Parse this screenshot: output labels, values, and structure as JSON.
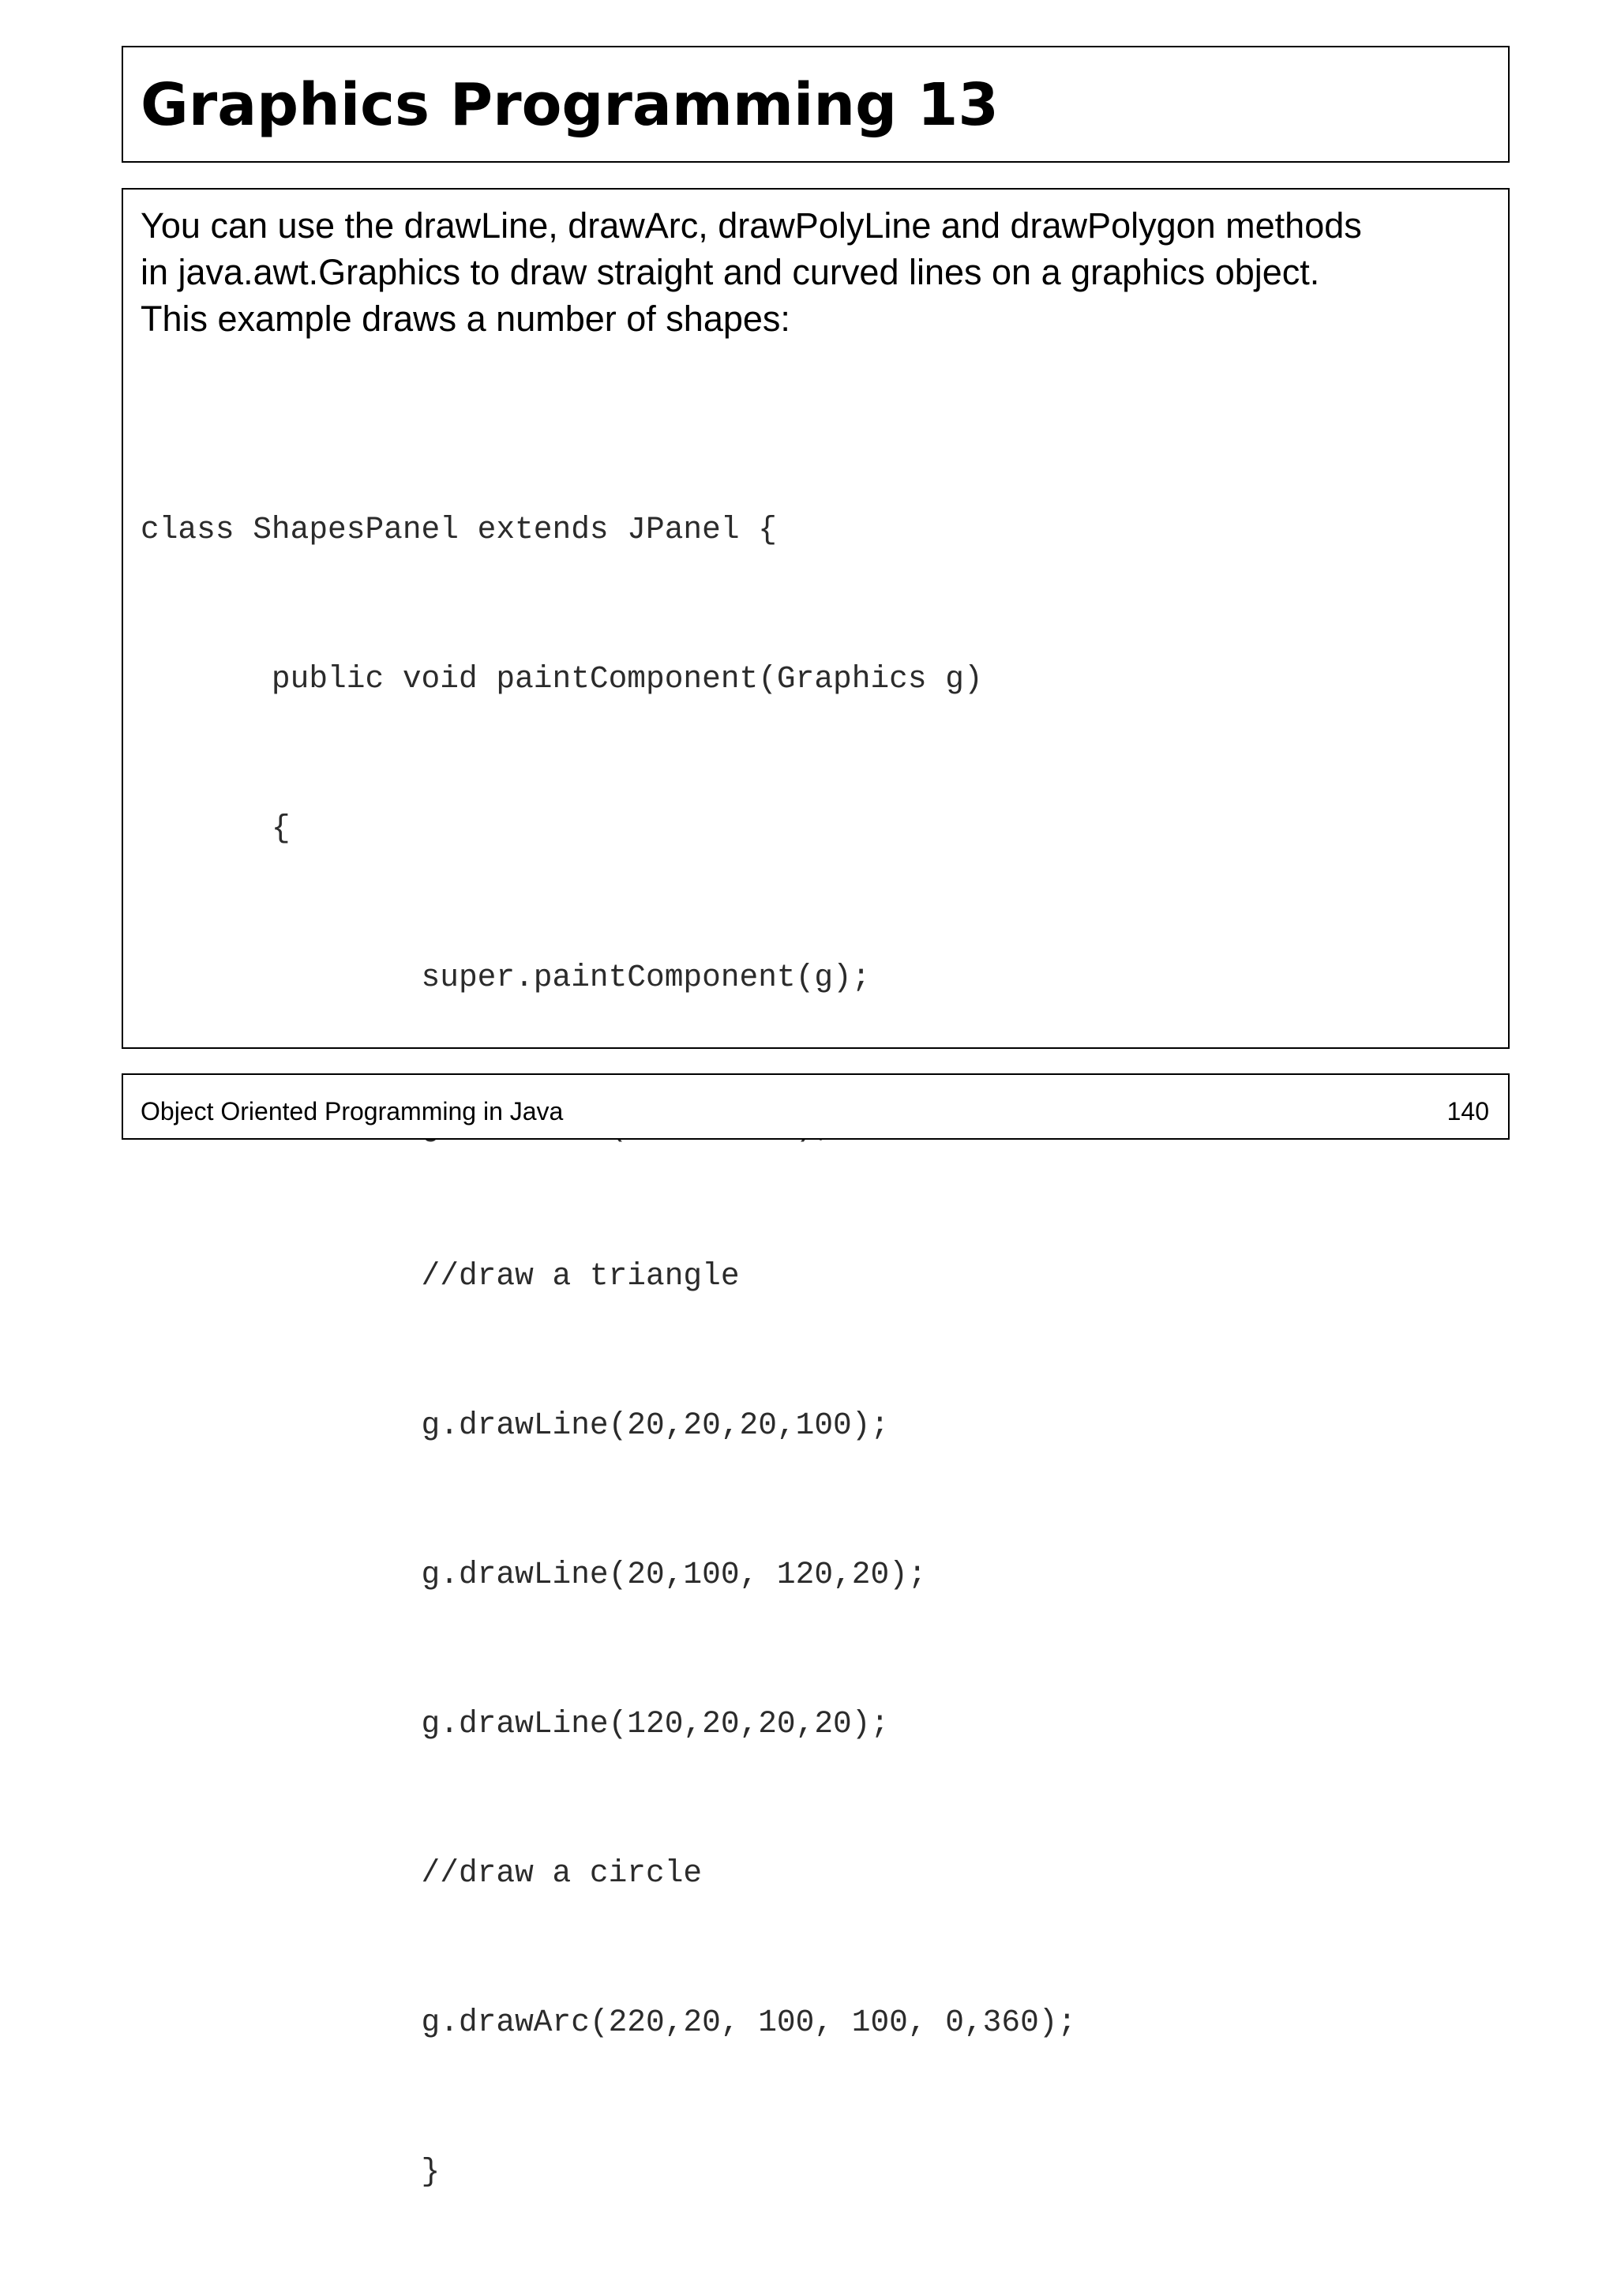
{
  "slide": {
    "title": "Graphics Programming 13",
    "intro_lines": [
      "You can use the drawLine, drawArc, drawPolyLine and drawPolygon methods",
      "in java.awt.Graphics to draw straight and curved lines on a graphics object.",
      "This example draws a number of shapes:"
    ],
    "code_lines": [
      "class ShapesPanel extends JPanel {",
      "       public void paintComponent(Graphics g)",
      "       {",
      "               super.paintComponent(g);",
      "               g.setColor(Color.red);",
      "               //draw a triangle",
      "               g.drawLine(20,20,20,100);",
      "               g.drawLine(20,100, 120,20);",
      "               g.drawLine(120,20,20,20);",
      "               //draw a circle",
      "               g.drawArc(220,20, 100, 100, 0,360);",
      "               }"
    ]
  },
  "footer": {
    "course": "Object Oriented Programming in Java",
    "page_number": "140"
  }
}
